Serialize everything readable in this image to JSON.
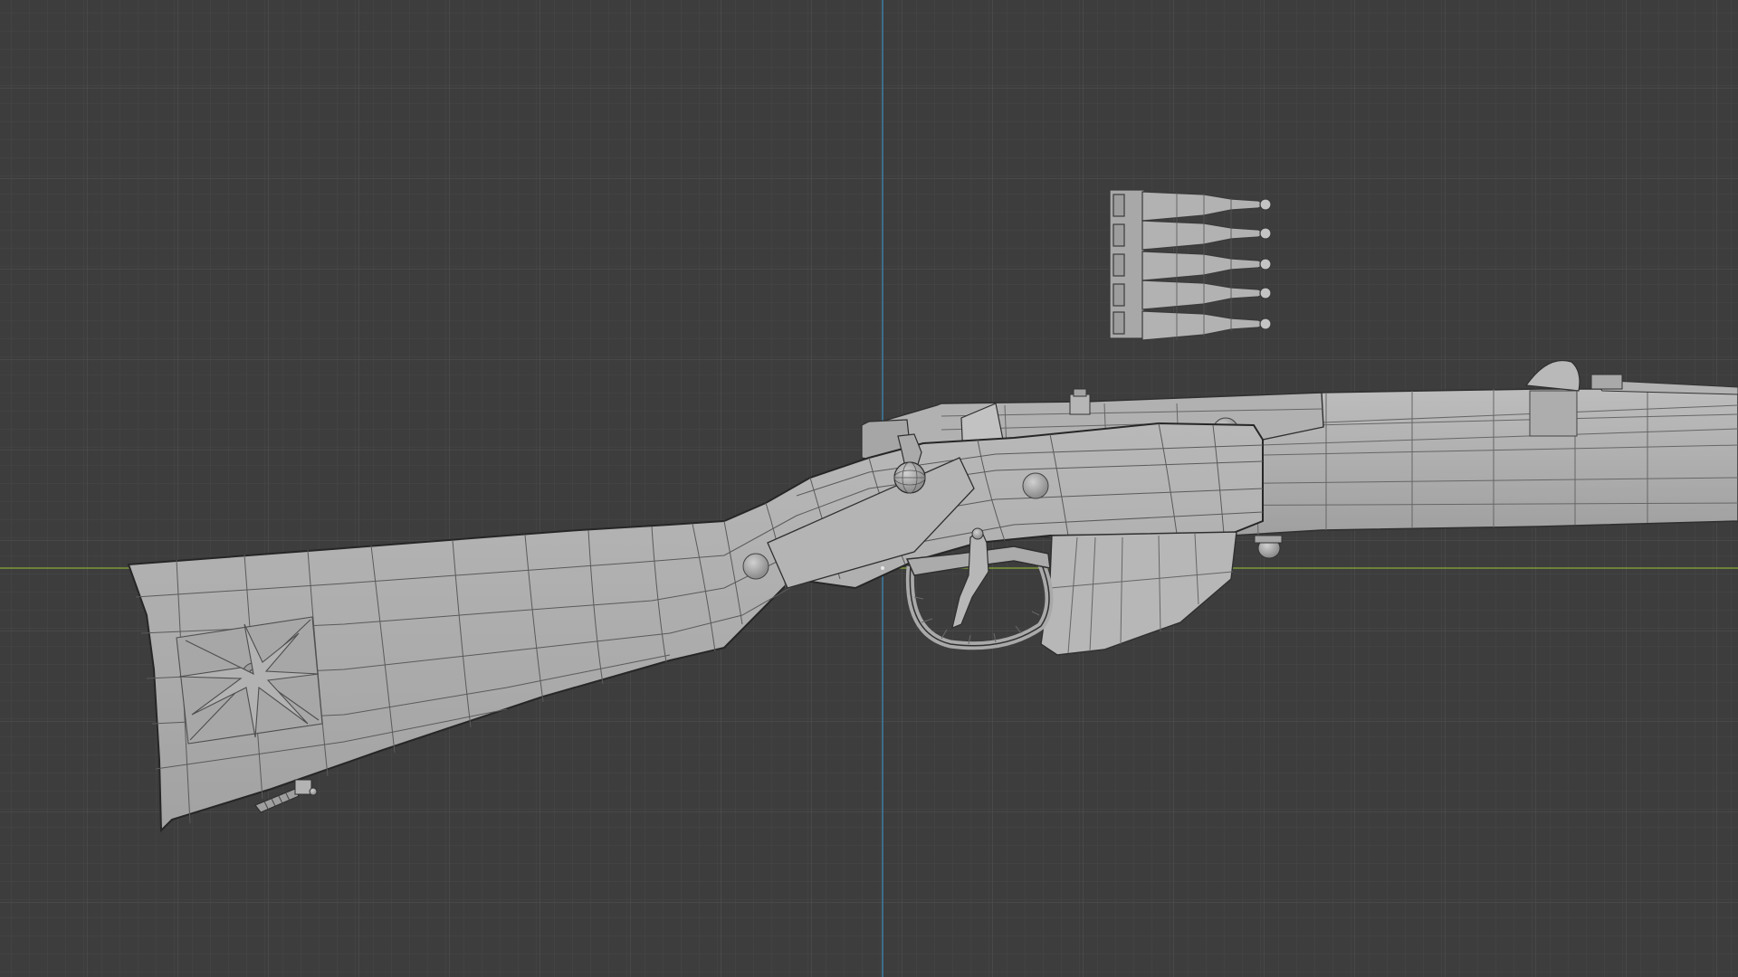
{
  "viewport": {
    "background": "#3d3d3d",
    "grid_minor_color": "#474747",
    "grid_major_color": "#525252",
    "x_axis_color": "#7f9a3a",
    "y_axis_color": "#3d7fa6",
    "mesh_fill": "#a9a9a9",
    "mesh_fill_light": "#b4b4b4",
    "mesh_wire": "#5c5c5c",
    "mesh_outline": "#2a2a2a"
  },
  "scene": {
    "objects": [
      {
        "name": "rifle-stock",
        "type": "mesh"
      },
      {
        "name": "receiver",
        "type": "mesh"
      },
      {
        "name": "barrel-forend",
        "type": "mesh"
      },
      {
        "name": "magazine",
        "type": "mesh"
      },
      {
        "name": "trigger-guard",
        "type": "mesh"
      },
      {
        "name": "trigger",
        "type": "mesh"
      },
      {
        "name": "bolt-handle",
        "type": "mesh"
      },
      {
        "name": "rear-sight",
        "type": "mesh"
      },
      {
        "name": "ammo-clip",
        "type": "mesh"
      },
      {
        "name": "buttplate-screw",
        "type": "mesh"
      }
    ]
  }
}
